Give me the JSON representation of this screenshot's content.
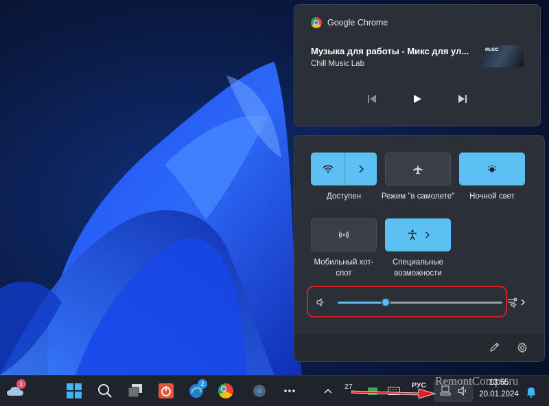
{
  "media": {
    "app_name": "Google Chrome",
    "title": "Музыка для работы - Микс для ул...",
    "artist": "Chill Music Lab",
    "thumbnail_text": "MUSIC"
  },
  "quick_settings": {
    "tiles": [
      {
        "id": "wifi",
        "label": "Доступен",
        "state": "on",
        "icon": "wifi-icon"
      },
      {
        "id": "airplane",
        "label": "Режим \"в самолете\"",
        "state": "off",
        "icon": "airplane-icon"
      },
      {
        "id": "night-light",
        "label": "Ночной свет",
        "state": "on",
        "icon": "night-light-icon"
      },
      {
        "id": "hotspot",
        "label": "Мобильный хот-спот",
        "state": "off",
        "icon": "hotspot-icon"
      },
      {
        "id": "accessibility",
        "label": "Специальные возможности",
        "state": "on",
        "icon": "accessibility-icon"
      }
    ],
    "volume": {
      "level": 0.29,
      "accent": "#5dc0f5"
    },
    "highlight_color": "#d21f2a"
  },
  "taskbar": {
    "weather_badge": "1",
    "edge_badge": "2",
    "language": "РУС",
    "tray_temp": "27",
    "time": "13:55",
    "date": "20.01.2024"
  },
  "watermark": "RemontCompa.ru"
}
